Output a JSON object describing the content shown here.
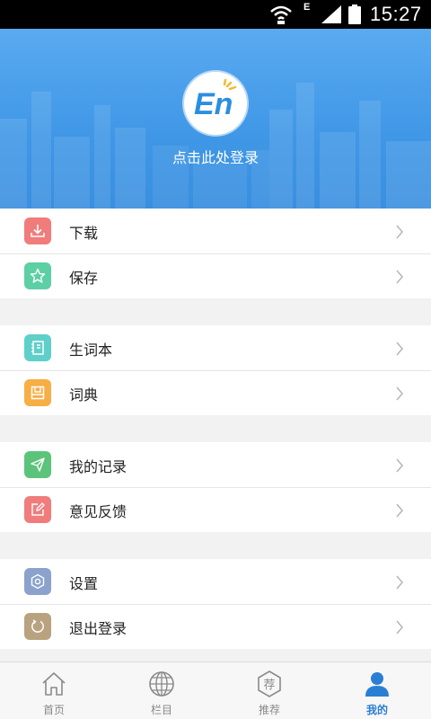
{
  "status_bar": {
    "network_type": "E",
    "time": "15:27"
  },
  "header": {
    "logo_text": "En",
    "login_prompt": "点击此处登录"
  },
  "menu": {
    "groups": [
      [
        {
          "label": "下载",
          "icon": "download-icon",
          "color": "#f07c7c"
        },
        {
          "label": "保存",
          "icon": "star-icon",
          "color": "#5dcfa4"
        }
      ],
      [
        {
          "label": "生词本",
          "icon": "notebook-icon",
          "color": "#5fcfc9"
        },
        {
          "label": "词典",
          "icon": "dictionary-icon",
          "color": "#f6ae45"
        }
      ],
      [
        {
          "label": "我的记录",
          "icon": "send-icon",
          "color": "#5cc47a"
        },
        {
          "label": "意见反馈",
          "icon": "edit-icon",
          "color": "#f07c7c"
        }
      ],
      [
        {
          "label": "设置",
          "icon": "settings-icon",
          "color": "#8aa2cc"
        },
        {
          "label": "退出登录",
          "icon": "logout-icon",
          "color": "#b9a27f"
        }
      ]
    ]
  },
  "tabbar": {
    "tabs": [
      {
        "label": "首页",
        "icon": "home-icon",
        "active": false
      },
      {
        "label": "栏目",
        "icon": "globe-icon",
        "active": false
      },
      {
        "label": "推荐",
        "icon": "recommend-icon",
        "active": false,
        "icon_text": "荐"
      },
      {
        "label": "我的",
        "icon": "user-icon",
        "active": true
      }
    ]
  },
  "colors": {
    "header_blue": "#4a9fea",
    "active_tab": "#2a7fd4"
  }
}
